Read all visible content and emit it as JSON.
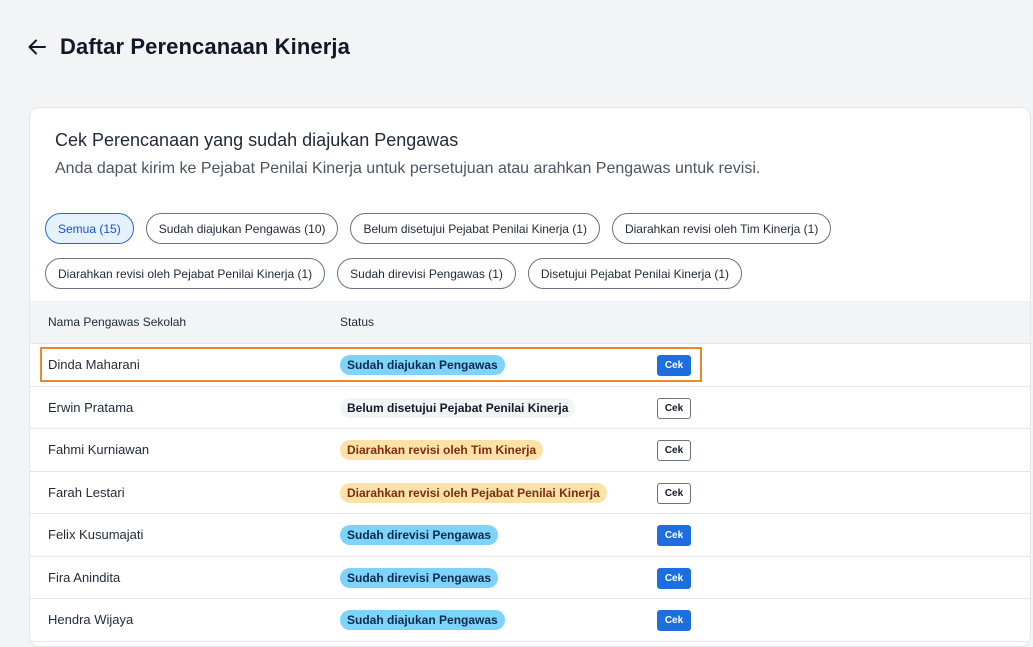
{
  "header": {
    "title": "Daftar Perencanaan Kinerja"
  },
  "card": {
    "title": "Cek Perencanaan yang sudah diajukan Pengawas",
    "subtitle": "Anda dapat kirim ke Pejabat Penilai Kinerja untuk persetujuan atau arahkan Pengawas untuk revisi."
  },
  "filters": [
    {
      "label": "Semua (15)",
      "active": true
    },
    {
      "label": "Sudah diajukan Pengawas (10)",
      "active": false
    },
    {
      "label": "Belum disetujui Pejabat Penilai Kinerja (1)",
      "active": false
    },
    {
      "label": "Diarahkan revisi oleh Tim Kinerja (1)",
      "active": false
    },
    {
      "label": "Diarahkan revisi oleh Pejabat Penilai Kinerja (1)",
      "active": false
    },
    {
      "label": "Sudah direvisi Pengawas (1)",
      "active": false
    },
    {
      "label": "Disetujui Pejabat Penilai Kinerja (1)",
      "active": false
    }
  ],
  "table": {
    "columns": {
      "name": "Nama Pengawas Sekolah",
      "status": "Status"
    },
    "rows": [
      {
        "name": "Dinda Maharani",
        "status": "Sudah diajukan Pengawas",
        "status_color": "blue",
        "action": "Cek",
        "action_style": "primary",
        "highlighted": true
      },
      {
        "name": "Erwin Pratama",
        "status": "Belum disetujui Pejabat Penilai Kinerja",
        "status_color": "gray",
        "action": "Cek",
        "action_style": "outline",
        "highlighted": false
      },
      {
        "name": "Fahmi Kurniawan",
        "status": "Diarahkan revisi oleh Tim Kinerja",
        "status_color": "orange",
        "action": "Cek",
        "action_style": "outline",
        "highlighted": false
      },
      {
        "name": "Farah Lestari",
        "status": "Diarahkan revisi oleh Pejabat Penilai Kinerja",
        "status_color": "orange",
        "action": "Cek",
        "action_style": "outline",
        "highlighted": false
      },
      {
        "name": "Felix Kusumajati",
        "status": "Sudah direvisi Pengawas",
        "status_color": "blue",
        "action": "Cek",
        "action_style": "primary",
        "highlighted": false
      },
      {
        "name": "Fira Anindita",
        "status": "Sudah direvisi Pengawas",
        "status_color": "blue",
        "action": "Cek",
        "action_style": "primary",
        "highlighted": false
      },
      {
        "name": "Hendra Wijaya",
        "status": "Sudah diajukan Pengawas",
        "status_color": "blue",
        "action": "Cek",
        "action_style": "primary",
        "highlighted": false
      }
    ]
  },
  "colors": {
    "primary": "#1d6fe0",
    "highlight": "#e8892b",
    "badge_blue": "#7dd3fc",
    "badge_orange": "#fde2a7",
    "badge_gray": "#f3f4f6"
  },
  "icons": {
    "back": "arrow-left-icon"
  }
}
